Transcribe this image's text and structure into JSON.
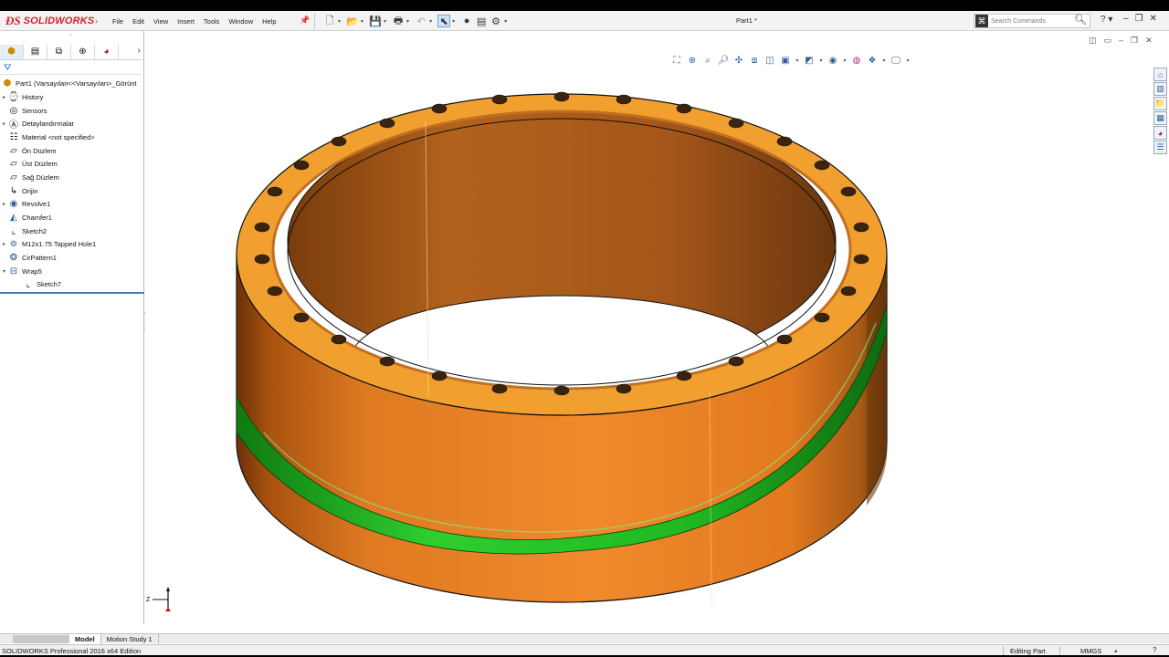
{
  "app": {
    "brand": "SOLIDWORKS",
    "document_title": "Part1 *",
    "menu": [
      "File",
      "Edit",
      "View",
      "Insert",
      "Tools",
      "Window",
      "Help"
    ],
    "search_placeholder": "Search Commands"
  },
  "feature_tree": {
    "root": "Part1  (Varsayılan<<Varsayılan>_Görünt",
    "items": [
      {
        "label": "History",
        "icon": "history-icon",
        "expandable": true
      },
      {
        "label": "Sensors",
        "icon": "sensors-icon",
        "expandable": false
      },
      {
        "label": "Detaylandırmalar",
        "icon": "annotations-icon",
        "expandable": true
      },
      {
        "label": "Material <not specified>",
        "icon": "material-icon",
        "expandable": false
      },
      {
        "label": "Ön Düzlem",
        "icon": "plane-icon",
        "expandable": false
      },
      {
        "label": "Üst Düzlem",
        "icon": "plane-icon",
        "expandable": false
      },
      {
        "label": "Sağ Düzlem",
        "icon": "plane-icon",
        "expandable": false
      },
      {
        "label": "Orijin",
        "icon": "origin-icon",
        "expandable": false
      },
      {
        "label": "Revolve1",
        "icon": "revolve-icon",
        "expandable": true
      },
      {
        "label": "Chamfer1",
        "icon": "chamfer-icon",
        "expandable": false
      },
      {
        "label": "Sketch2",
        "icon": "sketch-icon",
        "expandable": false
      },
      {
        "label": "M12x1.75 Tapped Hole1",
        "icon": "hole-icon",
        "expandable": true
      },
      {
        "label": "CirPattern1",
        "icon": "pattern-icon",
        "expandable": false
      },
      {
        "label": "Wrap5",
        "icon": "wrap-icon",
        "expandable": true,
        "expanded": true
      }
    ],
    "child": {
      "label": "Sketch7",
      "icon": "sketch-icon"
    }
  },
  "bottom_tabs": [
    "Model",
    "Motion Study 1"
  ],
  "status": {
    "edition": "SOLIDWORKS Professional 2016 x64 Edition",
    "mode": "Editing Part",
    "units": "MMGS"
  },
  "triad": {
    "z_label": "Z"
  },
  "colors": {
    "brand_red": "#d2232a",
    "part_copper": "#e07a22",
    "flange_gold": "#f1a030",
    "wrap_green": "#2bc52b",
    "selection_blue": "#3d7fc6"
  }
}
